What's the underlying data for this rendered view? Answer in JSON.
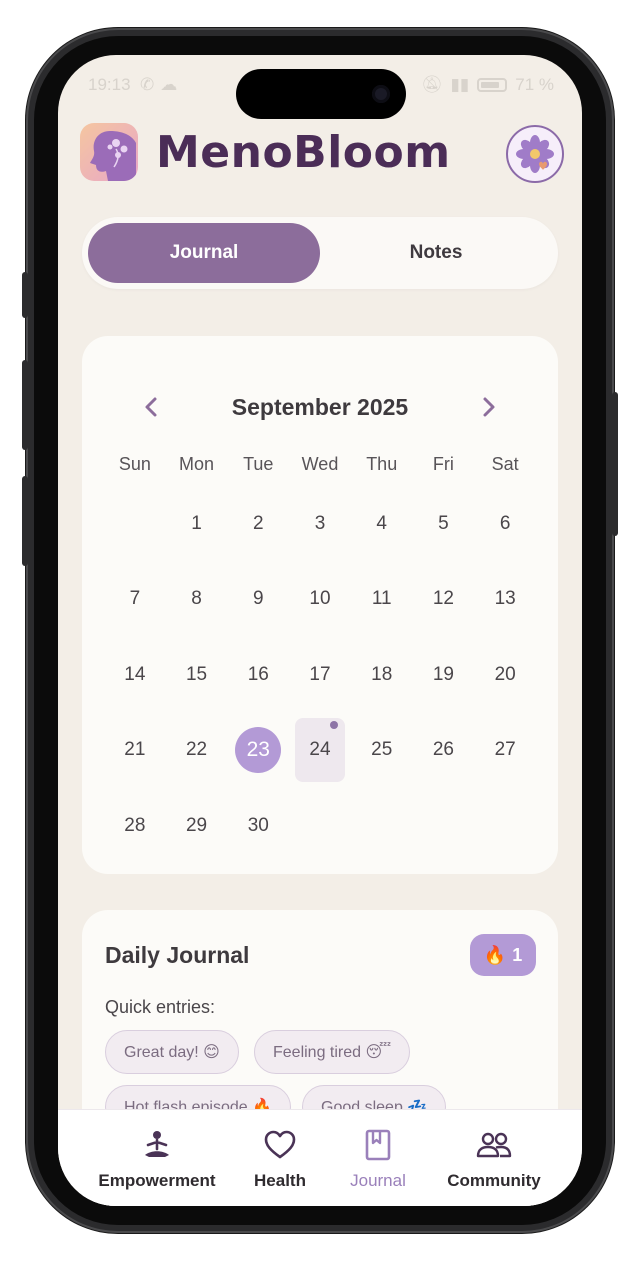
{
  "status_bar": {
    "time": "19:13",
    "battery": "71 %"
  },
  "header": {
    "app_name": "MenoBloom",
    "logo_icon": "woman-profile-flowers-icon",
    "profile_icon": "flower-heart-icon"
  },
  "segment": {
    "tabs": [
      {
        "label": "Journal",
        "active": true
      },
      {
        "label": "Notes",
        "active": false
      }
    ]
  },
  "calendar": {
    "month_title": "September 2025",
    "weekdays": [
      "Sun",
      "Mon",
      "Tue",
      "Wed",
      "Thu",
      "Fri",
      "Sat"
    ],
    "first_weekday_offset": 1,
    "days_in_month": 30,
    "selected_day": 23,
    "days_with_entries": [
      24
    ]
  },
  "journal": {
    "title": "Daily Journal",
    "streak_icon": "🔥",
    "streak_count": "1",
    "quick_entries_label": "Quick entries:",
    "quick_entries": [
      "Great day! 😊",
      "Feeling tired 😴",
      "Hot flash episode 🔥",
      "Good sleep 💤"
    ]
  },
  "tabbar": {
    "items": [
      {
        "label": "Empowerment",
        "icon": "meditation-icon",
        "active": false
      },
      {
        "label": "Health",
        "icon": "heart-icon",
        "active": false
      },
      {
        "label": "Journal",
        "icon": "book-icon",
        "active": true
      },
      {
        "label": "Community",
        "icon": "people-icon",
        "active": false
      }
    ]
  },
  "colors": {
    "accent": "#8c6d9b",
    "selected_day": "#b39ad6",
    "active_tab": "#9a80ba",
    "background": "#f3eee7"
  }
}
